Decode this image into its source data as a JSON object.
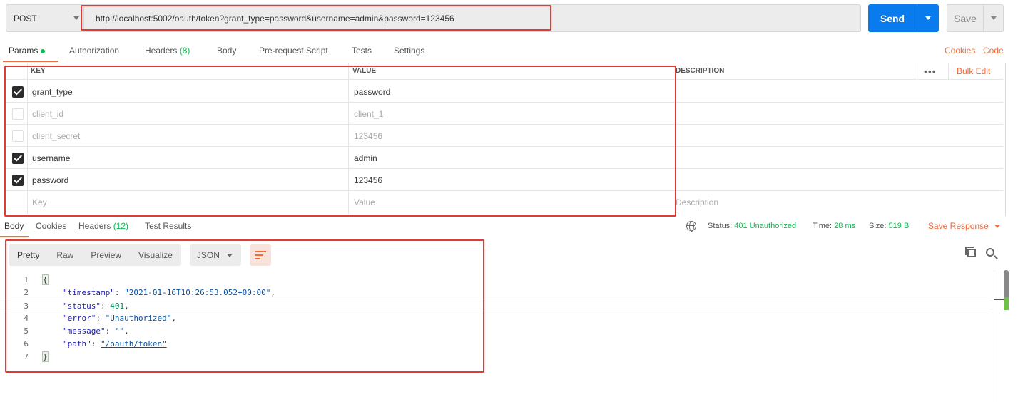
{
  "request": {
    "method": "POST",
    "url": "http://localhost:5002/oauth/token?grant_type=password&username=admin&password=123456",
    "send_label": "Send",
    "save_label": "Save"
  },
  "request_tabs": [
    {
      "label": "Params",
      "active": true
    },
    {
      "label": "Authorization"
    },
    {
      "label": "Headers",
      "count": "(8)"
    },
    {
      "label": "Body"
    },
    {
      "label": "Pre-request Script"
    },
    {
      "label": "Tests"
    },
    {
      "label": "Settings"
    }
  ],
  "request_links": {
    "cookies": "Cookies",
    "code": "Code"
  },
  "params": {
    "headers": {
      "key": "KEY",
      "value": "VALUE",
      "description": "DESCRIPTION"
    },
    "bulk_edit": "Bulk Edit",
    "more": "•••",
    "rows": [
      {
        "checked": true,
        "key": "grant_type",
        "value": "password"
      },
      {
        "checked": false,
        "key": "client_id",
        "value": "client_1"
      },
      {
        "checked": false,
        "key": "client_secret",
        "value": "123456"
      },
      {
        "checked": true,
        "key": "username",
        "value": "admin"
      },
      {
        "checked": true,
        "key": "password",
        "value": "123456"
      }
    ],
    "placeholder": {
      "key": "Key",
      "value": "Value",
      "description": "Description"
    }
  },
  "response_tabs": [
    {
      "label": "Body",
      "active": true
    },
    {
      "label": "Cookies"
    },
    {
      "label": "Headers",
      "count": "(12)"
    },
    {
      "label": "Test Results"
    }
  ],
  "response_status": {
    "status_label": "Status:",
    "status_value": "401 Unauthorized",
    "time_label": "Time:",
    "time_value": "28 ms",
    "size_label": "Size:",
    "size_value": "519 B",
    "save_response": "Save Response"
  },
  "viewer": {
    "modes": [
      "Pretty",
      "Raw",
      "Preview",
      "Visualize"
    ],
    "format": "JSON"
  },
  "code_lines": [
    {
      "n": "1",
      "text": "{"
    },
    {
      "n": "2",
      "key": "\"timestamp\"",
      "value": "\"2021-01-16T10:26:53.052+00:00\"",
      "type": "str",
      "comma": ","
    },
    {
      "n": "3",
      "key": "\"status\"",
      "value": "401",
      "type": "num",
      "comma": ","
    },
    {
      "n": "4",
      "key": "\"error\"",
      "value": "\"Unauthorized\"",
      "type": "str",
      "comma": ","
    },
    {
      "n": "5",
      "key": "\"message\"",
      "value": "\"\"",
      "type": "str",
      "comma": ","
    },
    {
      "n": "6",
      "key": "\"path\"",
      "value": "\"/oauth/token\"",
      "type": "link",
      "comma": ""
    },
    {
      "n": "7",
      "text": "}"
    }
  ],
  "colors": {
    "accent": "#f26b3a",
    "send": "#097bed",
    "success": "#0cbb52",
    "annotation": "#e53935"
  }
}
